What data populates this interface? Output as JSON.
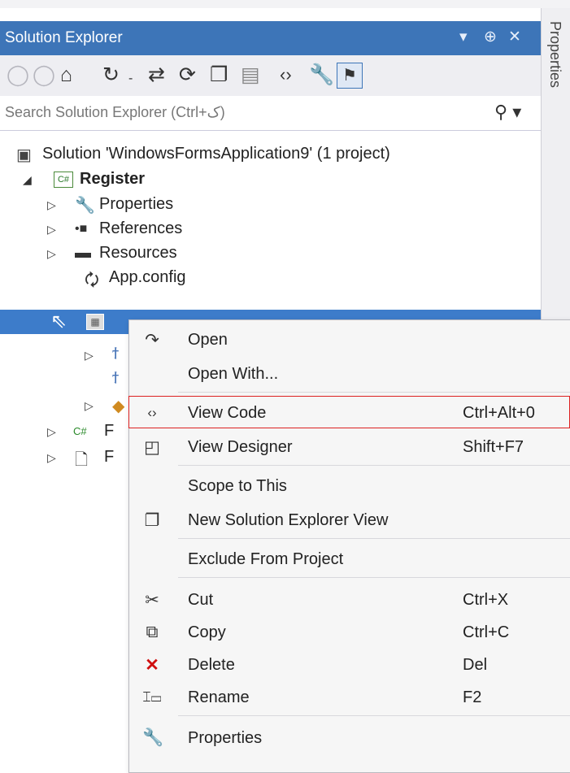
{
  "window": {
    "title": "Solution Explorer",
    "pin_glyph": "▾ ⊕ ✕"
  },
  "toolbar": {
    "icons": [
      "back-icon",
      "forward-icon",
      "home-icon",
      "history-icon",
      "sync-icon",
      "refresh-icon",
      "collapse-icon",
      "show-all-icon",
      "view-code-icon",
      "properties-icon",
      "preview-icon"
    ]
  },
  "search": {
    "placeholder": "Search Solution Explorer (Ctrl+ک)",
    "icon": "search-icon"
  },
  "side_tab": {
    "label": "Properties"
  },
  "tree": {
    "solution": "Solution 'WindowsFormsApplication9' (1 project)",
    "project": "Register",
    "items": [
      "Properties",
      "References",
      "Resources",
      "App.config"
    ],
    "partial": [
      "F",
      "F"
    ]
  },
  "menu": {
    "items": [
      {
        "label": "Open",
        "shortcut": "",
        "icon": "open-icon"
      },
      {
        "label": "Open With...",
        "shortcut": "",
        "icon": ""
      },
      {
        "label": "View Code",
        "shortcut": "Ctrl+Alt+0",
        "icon": "code-icon"
      },
      {
        "label": "View Designer",
        "shortcut": "Shift+F7",
        "icon": "designer-icon"
      },
      {
        "label": "Scope to This",
        "shortcut": "",
        "icon": ""
      },
      {
        "label": "New Solution Explorer View",
        "shortcut": "",
        "icon": "new-view-icon"
      },
      {
        "label": "Exclude From Project",
        "shortcut": "",
        "icon": ""
      },
      {
        "label": "Cut",
        "shortcut": "Ctrl+X",
        "icon": "cut-icon"
      },
      {
        "label": "Copy",
        "shortcut": "Ctrl+C",
        "icon": "copy-icon"
      },
      {
        "label": "Delete",
        "shortcut": "Del",
        "icon": "delete-icon"
      },
      {
        "label": "Rename",
        "shortcut": "F2",
        "icon": "rename-icon"
      },
      {
        "label": "Properties",
        "shortcut": "",
        "icon": "wrench-icon"
      }
    ]
  },
  "colors": {
    "titlebar": "#3d75b8",
    "selection": "#3d7cca",
    "highlight_border": "#dd2222",
    "delete_icon": "#d01010"
  }
}
